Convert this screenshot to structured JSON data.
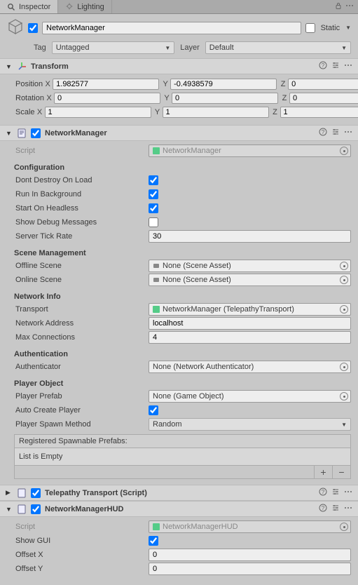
{
  "tabs": {
    "inspector": "Inspector",
    "lighting": "Lighting"
  },
  "header": {
    "name": "NetworkManager",
    "static_label": "Static",
    "tag_label": "Tag",
    "tag_value": "Untagged",
    "layer_label": "Layer",
    "layer_value": "Default"
  },
  "transform": {
    "title": "Transform",
    "position_label": "Position",
    "rotation_label": "Rotation",
    "scale_label": "Scale",
    "position": {
      "x": "1.982577",
      "y": "-0.4938579",
      "z": "0"
    },
    "rotation": {
      "x": "0",
      "y": "0",
      "z": "0"
    },
    "scale": {
      "x": "1",
      "y": "1",
      "z": "1"
    },
    "axis": {
      "X": "X",
      "Y": "Y",
      "Z": "Z"
    }
  },
  "networkManager": {
    "title": "NetworkManager",
    "script_label": "Script",
    "script_value": "NetworkManager",
    "sections": {
      "configuration": "Configuration",
      "scene_management": "Scene Management",
      "network_info": "Network Info",
      "authentication": "Authentication",
      "player_object": "Player Object"
    },
    "props": {
      "dont_destroy_label": "Dont Destroy On Load",
      "run_in_bg_label": "Run In Background",
      "start_headless_label": "Start On Headless",
      "show_debug_label": "Show Debug Messages",
      "tick_rate_label": "Server Tick Rate",
      "tick_rate_value": "30",
      "offline_scene_label": "Offline Scene",
      "offline_scene_value": "None (Scene Asset)",
      "online_scene_label": "Online Scene",
      "online_scene_value": "None (Scene Asset)",
      "transport_label": "Transport",
      "transport_value": "NetworkManager (TelepathyTransport)",
      "network_addr_label": "Network Address",
      "network_addr_value": "localhost",
      "max_conn_label": "Max Connections",
      "max_conn_value": "4",
      "authenticator_label": "Authenticator",
      "authenticator_value": "None (Network Authenticator)",
      "player_prefab_label": "Player Prefab",
      "player_prefab_value": "None (Game Object)",
      "auto_create_label": "Auto Create Player",
      "spawn_method_label": "Player Spawn Method",
      "spawn_method_value": "Random",
      "spawnable_header": "Registered Spawnable Prefabs:",
      "spawnable_empty": "List is Empty"
    }
  },
  "telepathy": {
    "title": "Telepathy Transport (Script)"
  },
  "hud": {
    "title": "NetworkManagerHUD",
    "script_label": "Script",
    "script_value": "NetworkManagerHUD",
    "show_gui_label": "Show GUI",
    "offset_x_label": "Offset X",
    "offset_x_value": "0",
    "offset_y_label": "Offset Y",
    "offset_y_value": "0"
  }
}
